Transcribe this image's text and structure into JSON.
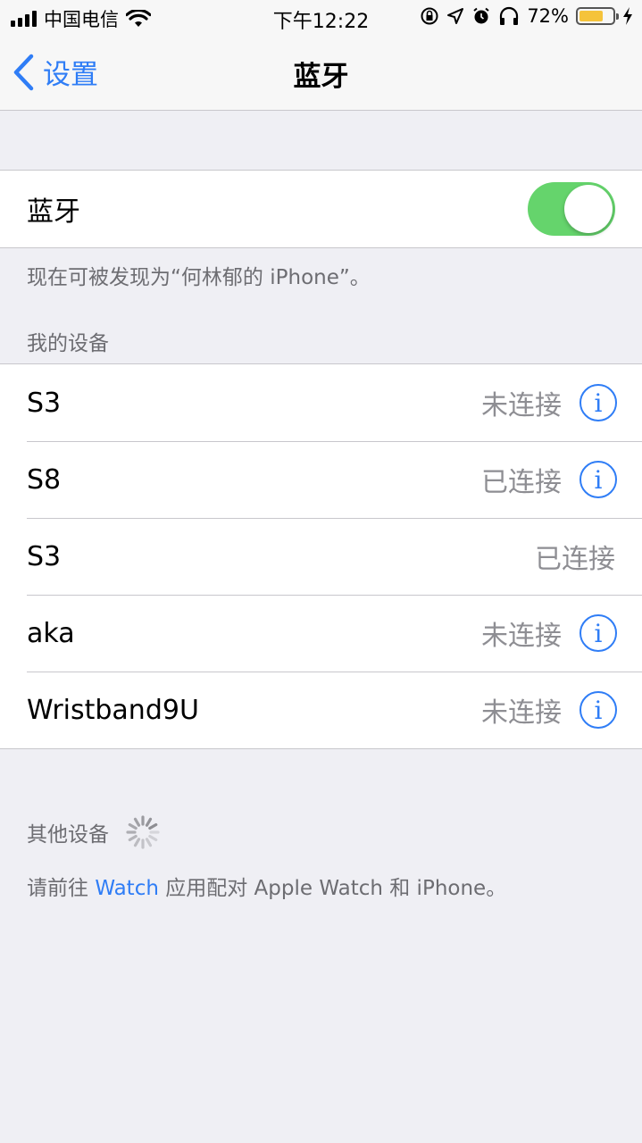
{
  "status_bar": {
    "carrier": "中国电信",
    "time": "下午12:22",
    "battery_percent": "72%",
    "battery_level": 0.72
  },
  "nav": {
    "back_label": "设置",
    "title": "蓝牙"
  },
  "bluetooth": {
    "label": "蓝牙",
    "enabled": true,
    "discoverable_text": "现在可被发现为“何林郁的 iPhone”。"
  },
  "my_devices": {
    "header": "我的设备",
    "devices": [
      {
        "name": "S3",
        "status": "未连接",
        "info": true
      },
      {
        "name": "S8",
        "status": "已连接",
        "info": true
      },
      {
        "name": "S3",
        "status": "已连接",
        "info": false
      },
      {
        "name": "aka",
        "status": "未连接",
        "info": true
      },
      {
        "name": "Wristband9U",
        "status": "未连接",
        "info": true
      }
    ]
  },
  "other_devices": {
    "header": "其他设备",
    "footer_prefix": "请前往 ",
    "footer_link": "Watch",
    "footer_suffix": " 应用配对 Apple Watch 和 iPhone。"
  },
  "colors": {
    "accent": "#2f7df6",
    "toggle_on": "#65d46c",
    "battery": "#f5c33b"
  }
}
